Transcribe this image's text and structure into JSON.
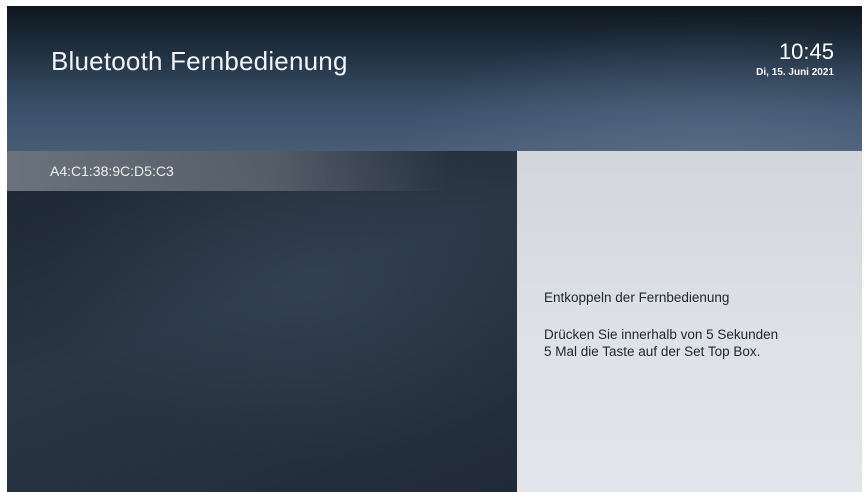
{
  "header": {
    "title": "Bluetooth Fernbedienung",
    "time": "10:45",
    "date": "Di, 15. Juni 2021"
  },
  "devices": [
    {
      "label": "A4:C1:38:9C:D5:C3",
      "selected": true
    }
  ],
  "info": {
    "title": "Entkoppeln der Fernbedienung",
    "instruction_line1": "Drücken Sie innerhalb von 5 Sekunden",
    "instruction_line2": "5 Mal die Taste auf der Set Top Box."
  },
  "colors": {
    "header_top": "#0f161e",
    "header_bottom": "#485c75",
    "left_panel": "#1f2a36",
    "right_panel": "#dde1e6",
    "selection": "#787f8a"
  }
}
